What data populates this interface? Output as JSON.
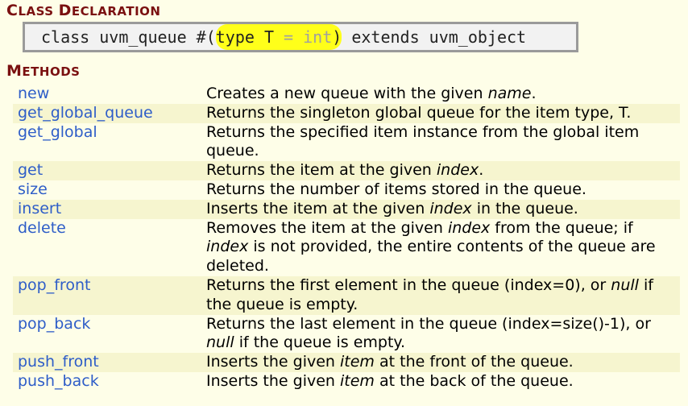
{
  "headings": {
    "class_declaration": {
      "first1": "C",
      "rest1": "LASS",
      "first2": "D",
      "rest2": "ECLARATION"
    },
    "methods": {
      "first": "M",
      "rest": "ETHODS"
    }
  },
  "declaration": {
    "pre": "class uvm_queue #(",
    "type_kw": "type T",
    "default": " = int",
    "close": ")",
    "post": " extends uvm_object"
  },
  "methods": [
    {
      "name": "new",
      "desc": [
        {
          "t": "Creates a new queue with the given "
        },
        {
          "t": "name",
          "i": true
        },
        {
          "t": "."
        }
      ]
    },
    {
      "name": "get_global_queue",
      "desc": [
        {
          "t": "Returns the singleton global queue for the item type, T."
        }
      ]
    },
    {
      "name": "get_global",
      "desc": [
        {
          "t": "Returns the specified item instance from the global item queue."
        }
      ]
    },
    {
      "name": "get",
      "desc": [
        {
          "t": "Returns the item at the given "
        },
        {
          "t": "index",
          "i": true
        },
        {
          "t": "."
        }
      ]
    },
    {
      "name": "size",
      "desc": [
        {
          "t": "Returns the number of items stored in the queue."
        }
      ]
    },
    {
      "name": "insert",
      "desc": [
        {
          "t": "Inserts the item at the given "
        },
        {
          "t": "index",
          "i": true
        },
        {
          "t": " in the queue."
        }
      ]
    },
    {
      "name": "delete",
      "desc": [
        {
          "t": "Removes the item at the given "
        },
        {
          "t": "index",
          "i": true
        },
        {
          "t": " from the queue; if "
        },
        {
          "t": "index",
          "i": true
        },
        {
          "t": " is not provided, the entire contents of the queue are deleted."
        }
      ]
    },
    {
      "name": "pop_front",
      "desc": [
        {
          "t": "Returns the first element in the queue (index=0), or "
        },
        {
          "t": "null",
          "i": true
        },
        {
          "t": " if the queue is empty."
        }
      ]
    },
    {
      "name": "pop_back",
      "desc": [
        {
          "t": "Returns the last element in the queue (index=size()-1), or "
        },
        {
          "t": "null",
          "i": true
        },
        {
          "t": " if the queue is empty."
        }
      ]
    },
    {
      "name": "push_front",
      "desc": [
        {
          "t": "Inserts the given "
        },
        {
          "t": "item",
          "i": true
        },
        {
          "t": " at the front of the queue."
        }
      ]
    },
    {
      "name": "push_back",
      "desc": [
        {
          "t": "Inserts the given "
        },
        {
          "t": "item",
          "i": true
        },
        {
          "t": " at the back of the queue."
        }
      ]
    }
  ]
}
